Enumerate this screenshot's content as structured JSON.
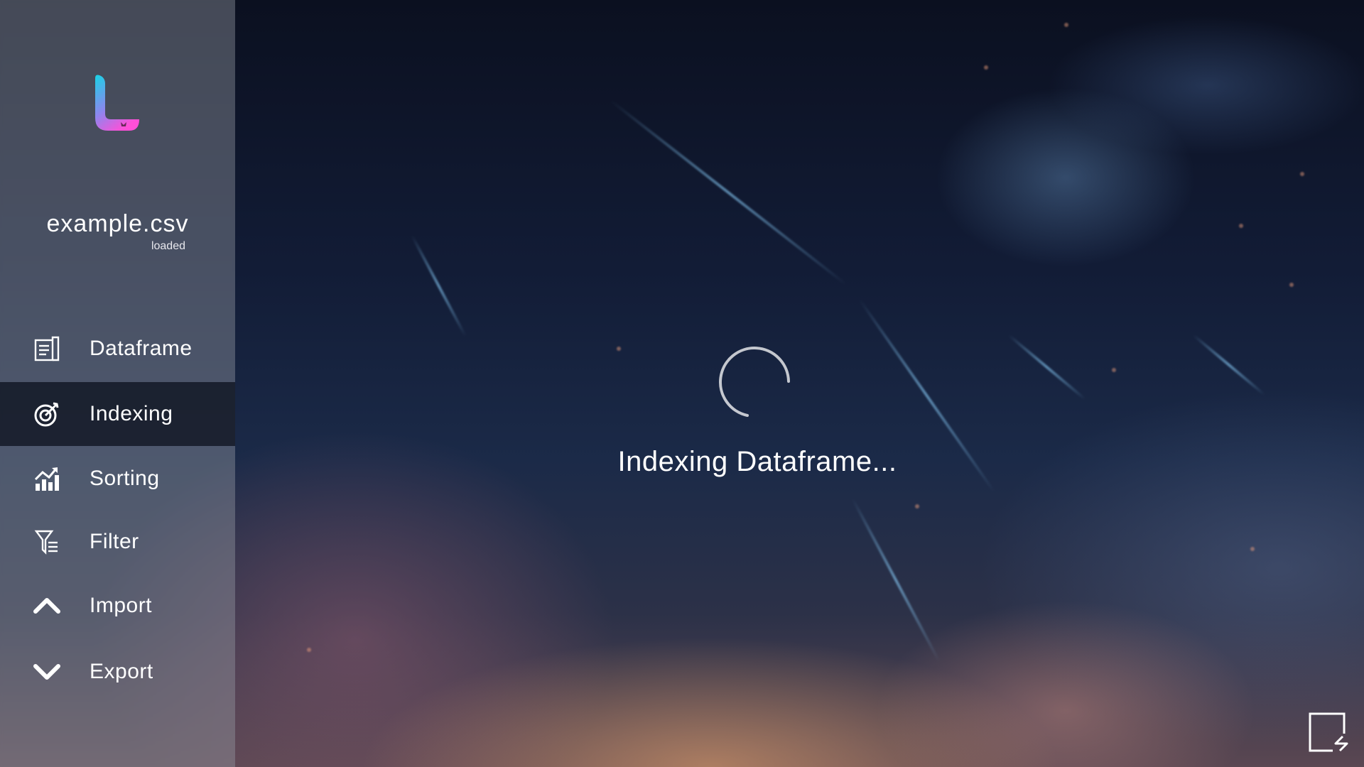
{
  "app": {
    "logo_icon": "app-logo-l",
    "accent_colors": [
      "#19d3e6",
      "#7a8ff0",
      "#ff4fd8"
    ]
  },
  "file": {
    "name": "example.csv",
    "status": "loaded"
  },
  "sidebar": {
    "items": [
      {
        "label": "Dataframe",
        "icon": "document-icon",
        "active": false
      },
      {
        "label": "Indexing",
        "icon": "target-icon",
        "active": true
      },
      {
        "label": "Sorting",
        "icon": "chart-trend-icon",
        "active": false
      },
      {
        "label": "Filter",
        "icon": "filter-icon",
        "active": false
      },
      {
        "label": "Import",
        "icon": "chevron-up-icon",
        "active": false
      },
      {
        "label": "Export",
        "icon": "chevron-down-icon",
        "active": false
      }
    ]
  },
  "main": {
    "loading_text": "Indexing Dataframe...",
    "spinner_icon": "loading-spinner-icon"
  },
  "corner": {
    "icon": "switch-view-icon"
  }
}
